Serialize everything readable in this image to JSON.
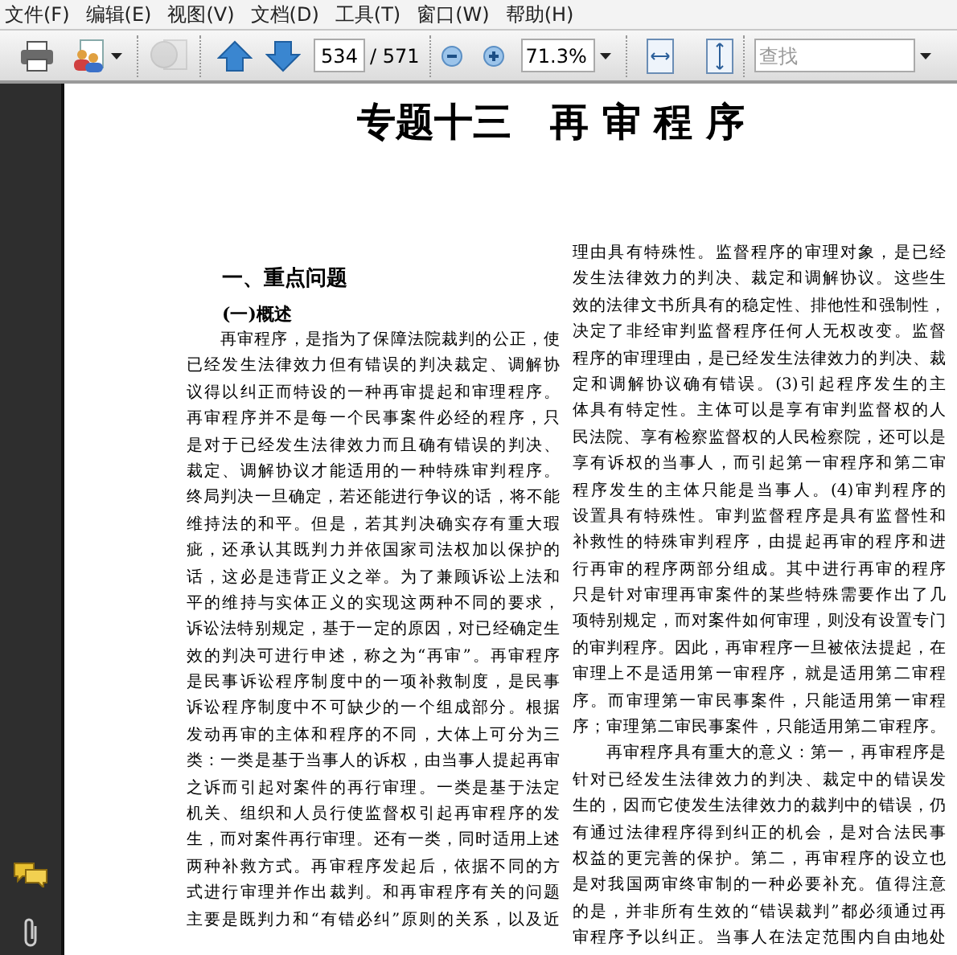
{
  "menu": [
    "文件(F)",
    "编辑(E)",
    "视图(V)",
    "文档(D)",
    "工具(T)",
    "窗口(W)",
    "帮助(H)"
  ],
  "toolbar": {
    "page_field": "534",
    "page_total": "/ 571",
    "zoom_field": "71.3%",
    "search": {
      "placeholder": "查找"
    },
    "globe_disabled": true
  },
  "document": {
    "title": "专题十三　再 审 程 序",
    "section_heading": "一、重点问题",
    "subheading": "(一)概述",
    "left_column": [
      {
        "text": "再审程序，是指为了保障法院裁判的公正，使",
        "indent": true
      },
      {
        "text": "已经发生法律效力但有错误的判决裁定、调解协",
        "indent": false
      },
      {
        "text": "议得以纠正而特设的一种再审提起和审理程序。",
        "indent": false
      },
      {
        "text": "再审程序并不是每一个民事案件必经的程序，只",
        "indent": false
      },
      {
        "text": "是对于已经发生法律效力而且确有错误的判决、",
        "indent": false
      },
      {
        "text": "裁定、调解协议才能适用的一种特殊审判程序。",
        "indent": false
      },
      {
        "text": "终局判决一旦确定，若还能进行争议的话，将不能",
        "indent": false
      },
      {
        "text": "维持法的和平。但是，若其判决确实存有重大瑕",
        "indent": false
      },
      {
        "text": "疵，还承认其既判力并依国家司法权加以保护的",
        "indent": false
      },
      {
        "text": "话，这必是违背正义之举。为了兼顾诉讼上法和",
        "indent": false
      },
      {
        "text": "平的维持与实体正义的实现这两种不同的要求，",
        "indent": false
      },
      {
        "text": "诉讼法特别规定，基于一定的原因，对已经确定生",
        "indent": false
      },
      {
        "text": "效的判决可进行申述，称之为“再审”。再审程序",
        "indent": false
      },
      {
        "text": "是民事诉讼程序制度中的一项补救制度，是民事",
        "indent": false
      },
      {
        "text": "诉讼程序制度中不可缺少的一个组成部分。根据",
        "indent": false
      },
      {
        "text": "发动再审的主体和程序的不同，大体上可分为三",
        "indent": false
      },
      {
        "text": "类：一类是基于当事人的诉权，由当事人提起再审",
        "indent": false
      },
      {
        "text": "之诉而引起对案件的再行审理。一类是基于法定",
        "indent": false
      },
      {
        "text": "机关、组织和人员行使监督权引起再审程序的发",
        "indent": false
      },
      {
        "text": "生，而对案件再行审理。还有一类，同时适用上述",
        "indent": false
      },
      {
        "text": "两种补救方式。再审程序发起后，依据不同的方",
        "indent": false
      },
      {
        "text": "式进行审理并作出裁判。和再审程序有关的问题",
        "indent": false
      },
      {
        "text": "主要是既判力和“有错必纠”原则的关系，以及近",
        "indent": false
      }
    ],
    "right_column": [
      {
        "text": "理由具有特殊性。监督程序的审理对象，是已经",
        "indent": false
      },
      {
        "text": "发生法律效力的判决、裁定和调解协议。这些生",
        "indent": false
      },
      {
        "text": "效的法律文书所具有的稳定性、排他性和强制性，",
        "indent": false
      },
      {
        "text": "决定了非经审判监督程序任何人无权改变。监督",
        "indent": false
      },
      {
        "text": "程序的审理理由，是已经发生法律效力的判决、裁",
        "indent": false
      },
      {
        "text": "定和调解协议确有错误。(3)引起程序发生的主",
        "indent": false
      },
      {
        "text": "体具有特定性。主体可以是享有审判监督权的人",
        "indent": false
      },
      {
        "text": "民法院、享有检察监督权的人民检察院，还可以是",
        "indent": false
      },
      {
        "text": "享有诉权的当事人，而引起第一审程序和第二审",
        "indent": false
      },
      {
        "text": "程序发生的主体只能是当事人。(4)审判程序的",
        "indent": false
      },
      {
        "text": "设置具有特殊性。审判监督程序是具有监督性和",
        "indent": false
      },
      {
        "text": "补救性的特殊审判程序，由提起再审的程序和进",
        "indent": false
      },
      {
        "text": "行再审的程序两部分组成。其中进行再审的程序",
        "indent": false
      },
      {
        "text": "只是针对审理再审案件的某些特殊需要作出了几",
        "indent": false
      },
      {
        "text": "项特别规定，而对案件如何审理，则没有设置专门",
        "indent": false
      },
      {
        "text": "的审判程序。因此，再审程序一旦被依法提起，在",
        "indent": false
      },
      {
        "text": "审理上不是适用第一审程序，就是适用第二审程",
        "indent": false
      },
      {
        "text": "序。而审理第一审民事案件，只能适用第一审程",
        "indent": false
      },
      {
        "text": "序；审理第二审民事案件，只能适用第二审程序。",
        "indent": false
      },
      {
        "text": "再审程序具有重大的意义：第一，再审程序是",
        "indent": true
      },
      {
        "text": "针对已经发生法律效力的判决、裁定中的错误发",
        "indent": false
      },
      {
        "text": "生的，因而它使发生法律效力的裁判中的错误，仍",
        "indent": false
      },
      {
        "text": "有通过法律程序得到纠正的机会，是对合法民事",
        "indent": false
      },
      {
        "text": "权益的更完善的保护。第二，再审程序的设立也",
        "indent": false
      },
      {
        "text": "是对我国两审终审制的一种必要补充。值得注意",
        "indent": false
      },
      {
        "text": "的是，并非所有生效的“错误裁判”都必须通过再",
        "indent": false
      },
      {
        "text": "审程序予以纠正。当事人在法定范围内自由地处",
        "indent": false
      }
    ]
  }
}
